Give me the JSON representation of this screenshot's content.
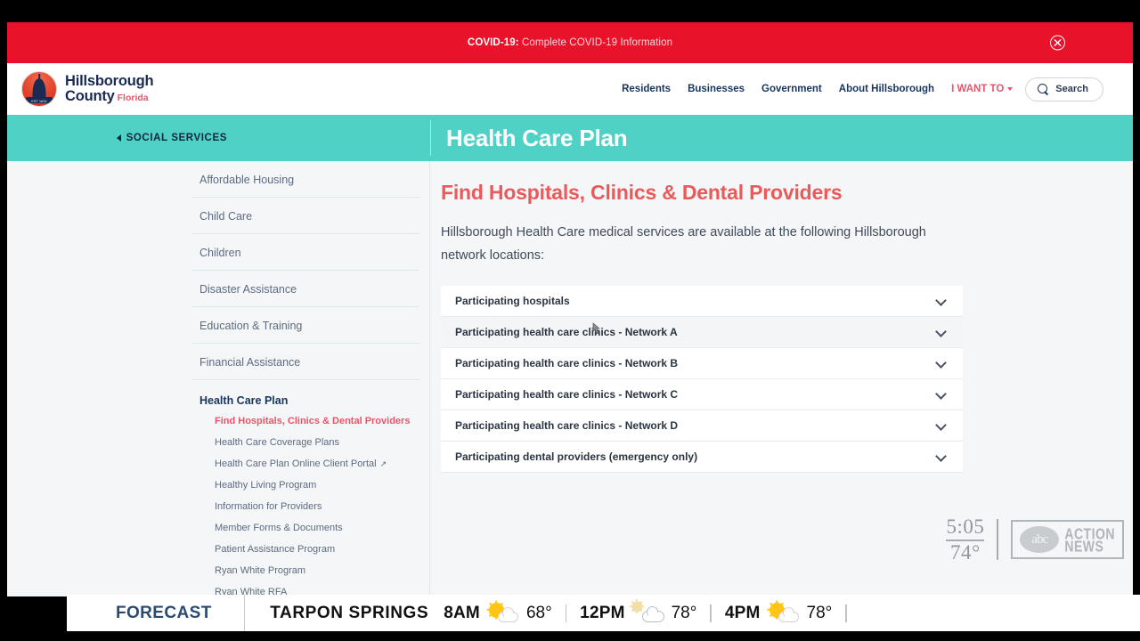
{
  "banner": {
    "prefix": "COVID-19:",
    "message": " Complete COVID-19 Information",
    "close_label": "close"
  },
  "header": {
    "logo": {
      "line1": "Hillsborough",
      "line2": "County",
      "state": "Florida",
      "seal_text": "EST 1834"
    },
    "nav": [
      {
        "label": "Residents"
      },
      {
        "label": "Businesses"
      },
      {
        "label": "Government"
      },
      {
        "label": "About Hillsborough"
      },
      {
        "label": "I WANT TO",
        "accent": true
      }
    ],
    "search_label": "Search"
  },
  "teal": {
    "breadcrumb": "SOCIAL SERVICES",
    "page_title": "Health Care Plan"
  },
  "sidebar": {
    "items": [
      {
        "label": "Affordable Housing"
      },
      {
        "label": "Child Care"
      },
      {
        "label": "Children"
      },
      {
        "label": "Disaster Assistance"
      },
      {
        "label": "Education & Training"
      },
      {
        "label": "Financial Assistance"
      },
      {
        "label": "Health Care Plan",
        "current": true
      }
    ],
    "sub_items": [
      {
        "label": "Find Hospitals, Clinics & Dental Providers",
        "active": true
      },
      {
        "label": "Health Care Coverage Plans"
      },
      {
        "label": "Health Care Plan Online Client Portal",
        "external": true
      },
      {
        "label": "Healthy Living Program"
      },
      {
        "label": "Information for Providers"
      },
      {
        "label": "Member Forms & Documents"
      },
      {
        "label": "Patient Assistance Program"
      },
      {
        "label": "Ryan White Program"
      },
      {
        "label": "Ryan White RFA"
      }
    ]
  },
  "content": {
    "heading": "Find Hospitals, Clinics & Dental Providers",
    "paragraph": "Hillsborough Health Care medical services are available at the following Hillsborough network locations:",
    "accordion": [
      {
        "label": "Participating hospitals"
      },
      {
        "label": "Participating health care clinics - Network A"
      },
      {
        "label": "Participating health care clinics - Network B"
      },
      {
        "label": "Participating health care clinics - Network C"
      },
      {
        "label": "Participating health care clinics - Network D"
      },
      {
        "label": "Participating dental providers (emergency only)"
      }
    ]
  },
  "broadcast": {
    "clock_time": "5:05",
    "clock_temp": "74°",
    "logo_abc": "abc",
    "logo_line1": "ACTION",
    "logo_line2": "NEWS"
  },
  "forecast": {
    "title": "FORECAST",
    "city": "TARPON SPRINGS",
    "slots": [
      {
        "time": "8AM",
        "temp": "68°",
        "icon": "sun-cloud-icon"
      },
      {
        "time": "12PM",
        "temp": "78°",
        "icon": "partly-cloudy-icon"
      },
      {
        "time": "4PM",
        "temp": "78°",
        "icon": "sun-cloud-icon"
      }
    ]
  },
  "colors": {
    "banner_red": "#e8122b",
    "teal": "#4fd1c5",
    "accent_red": "#ea5a5a",
    "navy": "#17355f"
  }
}
